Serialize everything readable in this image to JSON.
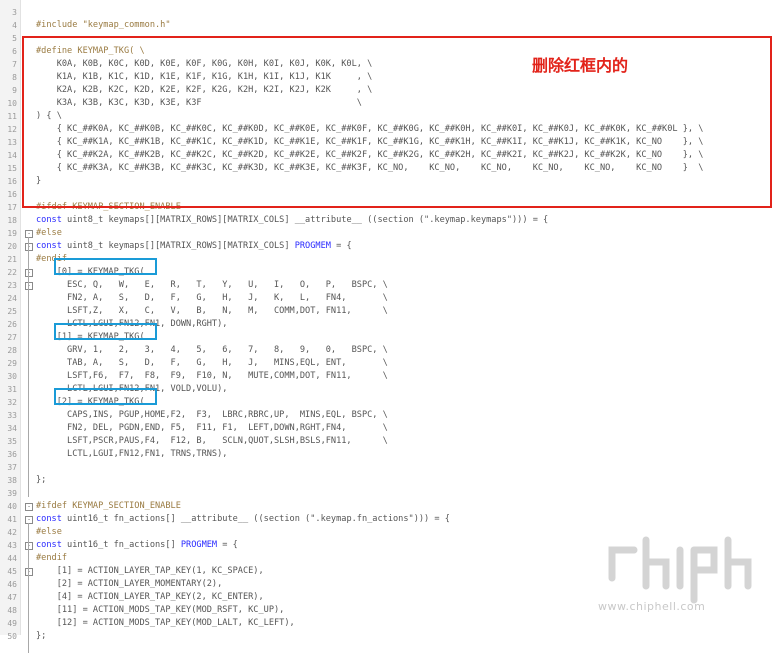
{
  "annotation": {
    "red_label": "删除红框内的"
  },
  "watermark": {
    "text": "www.chiphell.com"
  },
  "colors": {
    "red_box": "#e2231a",
    "blue_box": "#1a9bd7",
    "keyword": "#2a2aff",
    "number": "#d9822b"
  },
  "lines": [
    {
      "n": "3",
      "t": ""
    },
    {
      "n": "4",
      "t": "#include \"keymap_common.h\""
    },
    {
      "n": "5",
      "t": ""
    },
    {
      "n": "6",
      "t": "#define KEYMAP_TKG( \\"
    },
    {
      "n": "7",
      "t": "    K0A, K0B, K0C, K0D, K0E, K0F, K0G, K0H, K0I, K0J, K0K, K0L, \\"
    },
    {
      "n": "8",
      "t": "    K1A, K1B, K1C, K1D, K1E, K1F, K1G, K1H, K1I, K1J, K1K     , \\"
    },
    {
      "n": "9",
      "t": "    K2A, K2B, K2C, K2D, K2E, K2F, K2G, K2H, K2I, K2J, K2K     , \\"
    },
    {
      "n": "10",
      "t": "    K3A, K3B, K3C, K3D, K3E, K3F                              \\"
    },
    {
      "n": "11",
      "t": ") { \\"
    },
    {
      "n": "12",
      "t": "    { KC_##K0A, KC_##K0B, KC_##K0C, KC_##K0D, KC_##K0E, KC_##K0F, KC_##K0G, KC_##K0H, KC_##K0I, KC_##K0J, KC_##K0K, KC_##K0L }, \\"
    },
    {
      "n": "13",
      "t": "    { KC_##K1A, KC_##K1B, KC_##K1C, KC_##K1D, KC_##K1E, KC_##K1F, KC_##K1G, KC_##K1H, KC_##K1I, KC_##K1J, KC_##K1K, KC_NO    }, \\"
    },
    {
      "n": "14",
      "t": "    { KC_##K2A, KC_##K2B, KC_##K2C, KC_##K2D, KC_##K2E, KC_##K2F, KC_##K2G, KC_##K2H, KC_##K2I, KC_##K2J, KC_##K2K, KC_NO    }, \\"
    },
    {
      "n": "15",
      "t": "    { KC_##K3A, KC_##K3B, KC_##K3C, KC_##K3D, KC_##K3E, KC_##K3F, KC_NO,    KC_NO,    KC_NO,    KC_NO,    KC_NO,    KC_NO    }  \\"
    },
    {
      "n": "16",
      "t": "}"
    },
    {
      "n": "16",
      "t": ""
    },
    {
      "n": "17",
      "t": "#ifdef KEYMAP_SECTION_ENABLE"
    },
    {
      "n": "18",
      "t": "const uint8_t keymaps[][MATRIX_ROWS][MATRIX_COLS] __attribute__ ((section (\".keymap.keymaps\"))) = {"
    },
    {
      "n": "19",
      "t": "#else"
    },
    {
      "n": "20",
      "t": "const uint8_t keymaps[][MATRIX_ROWS][MATRIX_COLS] PROGMEM = {"
    },
    {
      "n": "21",
      "t": "#endif"
    },
    {
      "n": "22",
      "t": "    [0] = KEYMAP_TKG("
    },
    {
      "n": "23",
      "t": "      ESC, Q,   W,   E,   R,   T,   Y,   U,   I,   O,   P,   BSPC, \\"
    },
    {
      "n": "24",
      "t": "      FN2, A,   S,   D,   F,   G,   H,   J,   K,   L,   FN4,       \\"
    },
    {
      "n": "25",
      "t": "      LSFT,Z,   X,   C,   V,   B,   N,   M,   COMM,DOT, FN11,      \\"
    },
    {
      "n": "26",
      "t": "      LCTL,LGUI,FN12,FN1, DOWN,RGHT),"
    },
    {
      "n": "27",
      "t": "    [1] = KEYMAP_TKG("
    },
    {
      "n": "28",
      "t": "      GRV, 1,   2,   3,   4,   5,   6,   7,   8,   9,   0,   BSPC, \\"
    },
    {
      "n": "29",
      "t": "      TAB, A,   S,   D,   F,   G,   H,   J,   MINS,EQL, ENT,       \\"
    },
    {
      "n": "30",
      "t": "      LSFT,F6,  F7,  F8,  F9,  F10, N,   MUTE,COMM,DOT, FN11,      \\"
    },
    {
      "n": "31",
      "t": "      LCTL,LGUI,FN12,FN1, VOLD,VOLU),"
    },
    {
      "n": "32",
      "t": "    [2] = KEYMAP_TKG("
    },
    {
      "n": "33",
      "t": "      CAPS,INS, PGUP,HOME,F2,  F3,  LBRC,RBRC,UP,  MINS,EQL, BSPC, \\"
    },
    {
      "n": "34",
      "t": "      FN2, DEL, PGDN,END, F5,  F11, F1,  LEFT,DOWN,RGHT,FN4,       \\"
    },
    {
      "n": "35",
      "t": "      LSFT,PSCR,PAUS,F4,  F12, B,   SCLN,QUOT,SLSH,BSLS,FN11,      \\"
    },
    {
      "n": "36",
      "t": "      LCTL,LGUI,FN12,FN1, TRNS,TRNS),"
    },
    {
      "n": "37",
      "t": ""
    },
    {
      "n": "38",
      "t": "};"
    },
    {
      "n": "39",
      "t": ""
    },
    {
      "n": "40",
      "t": "#ifdef KEYMAP_SECTION_ENABLE"
    },
    {
      "n": "41",
      "t": "const uint16_t fn_actions[] __attribute__ ((section (\".keymap.fn_actions\"))) = {"
    },
    {
      "n": "42",
      "t": "#else"
    },
    {
      "n": "43",
      "t": "const uint16_t fn_actions[] PROGMEM = {"
    },
    {
      "n": "44",
      "t": "#endif"
    },
    {
      "n": "45",
      "t": "    [1] = ACTION_LAYER_TAP_KEY(1, KC_SPACE),"
    },
    {
      "n": "46",
      "t": "    [2] = ACTION_LAYER_MOMENTARY(2),"
    },
    {
      "n": "47",
      "t": "    [4] = ACTION_LAYER_TAP_KEY(2, KC_ENTER),"
    },
    {
      "n": "48",
      "t": "    [11] = ACTION_MODS_TAP_KEY(MOD_RSFT, KC_UP),"
    },
    {
      "n": "49",
      "t": "    [12] = ACTION_MODS_TAP_KEY(MOD_LALT, KC_LEFT),"
    },
    {
      "n": "50",
      "t": "};"
    }
  ]
}
